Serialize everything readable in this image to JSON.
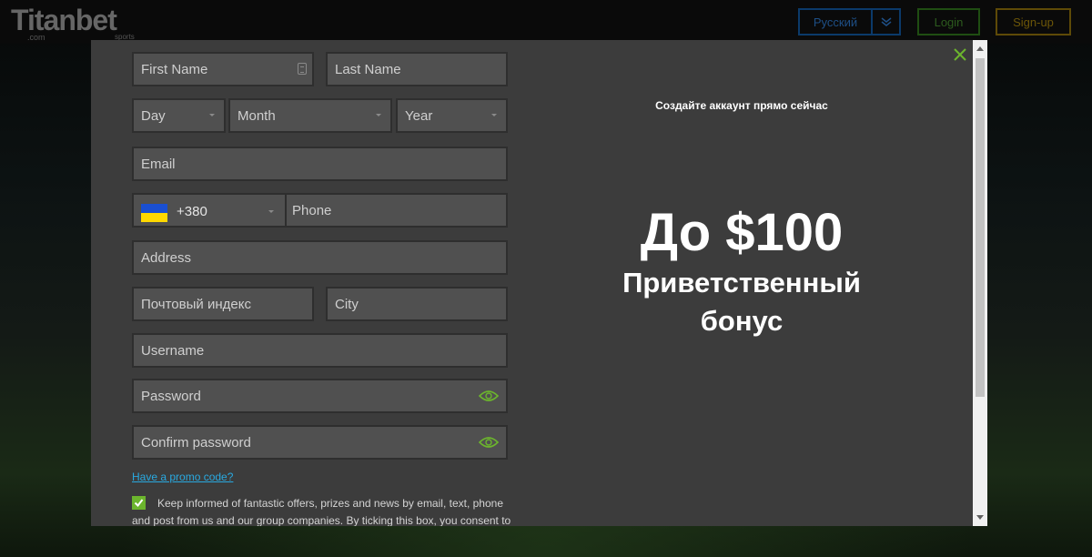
{
  "header": {
    "logo_text": "Titanbet",
    "logo_sub": ".com",
    "logo_sub2": "sports",
    "language_label": "Русский",
    "login_label": "Login",
    "signup_label": "Sign-up"
  },
  "form": {
    "first_name_placeholder": "First Name",
    "last_name_placeholder": "Last Name",
    "day_placeholder": "Day",
    "month_placeholder": "Month",
    "year_placeholder": "Year",
    "email_placeholder": "Email",
    "phone_prefix": "+380",
    "phone_placeholder": "Phone",
    "address_placeholder": "Address",
    "postcode_placeholder": "Почтовый индекс",
    "city_placeholder": "City",
    "username_placeholder": "Username",
    "password_placeholder": "Password",
    "confirm_password_placeholder": "Confirm password",
    "promo_link": "Have a promo code?",
    "consent_checked": true,
    "consent_text": "Keep informed of fantastic offers, prizes and news by email, text, phone and post from us and our group companies. By ticking this box, you consent to"
  },
  "promo_panel": {
    "title": "Создайте аккаунт прямо сейчас",
    "amount": "До $100",
    "bonus_text": "Приветственный бонус"
  },
  "colors": {
    "accent_green": "#6cb52d",
    "link_blue": "#29a9e0",
    "modal_bg": "#3c3c3c",
    "field_bg": "#505050"
  },
  "icons": {
    "close": "close-icon",
    "eye": "eye-icon",
    "id_card": "id-card-icon",
    "flag": "ukraine-flag-icon"
  }
}
